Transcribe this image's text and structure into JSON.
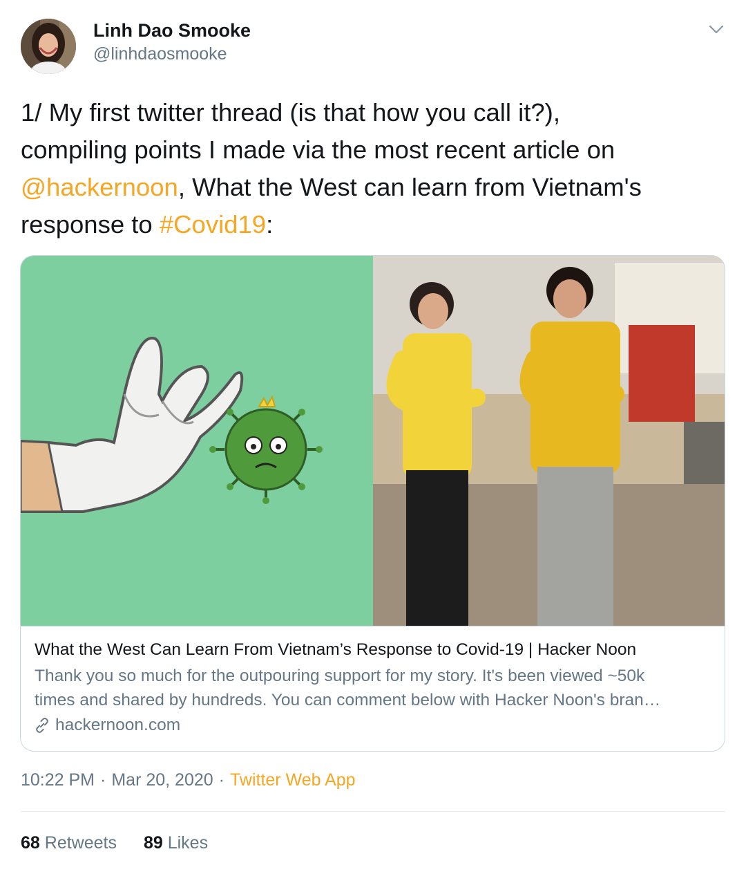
{
  "author": {
    "name": "Linh Dao Smooke",
    "handle": "@linhdaosmooke"
  },
  "tweet": {
    "lines": [
      [
        {
          "text": "1/ My first twitter thread (is that how you call it?),"
        }
      ],
      [
        {
          "text": "compiling points I made via the most recent article on"
        }
      ],
      [
        {
          "text": "@hackernoon",
          "link": true
        },
        {
          "text": ", What the West can learn from Vietnam's"
        }
      ],
      [
        {
          "text": "response to "
        },
        {
          "text": "#Covid19",
          "link": true
        },
        {
          "text": ":"
        }
      ]
    ]
  },
  "card": {
    "title": "What the West Can Learn From Vietnam’s Response to Covid-19 | Hacker Noon",
    "description_lines": [
      "Thank you so much for the outpouring support for my story. It's been viewed ~50k",
      "times and shared by hundreds. You can comment below with Hacker Noon's bran…"
    ],
    "domain": "hackernoon.com",
    "media": {
      "left_bg": "#7ecfa0",
      "right_bg": "#c9b89a",
      "virus_color": "#4f9a3a",
      "shirt_color": "#f3d33a",
      "jacket_color": "#e8b820",
      "sign_color": "#c0392b"
    }
  },
  "meta": {
    "time": "10:22 PM",
    "date": "Mar 20, 2020",
    "app": "Twitter Web App"
  },
  "stats": {
    "retweets_count": "68",
    "retweets_label": "Retweets",
    "likes_count": "89",
    "likes_label": "Likes"
  },
  "colors": {
    "accent": "#f5a623",
    "text": "#14171a",
    "secondary": "#657786",
    "border": "#ccd6dd"
  }
}
